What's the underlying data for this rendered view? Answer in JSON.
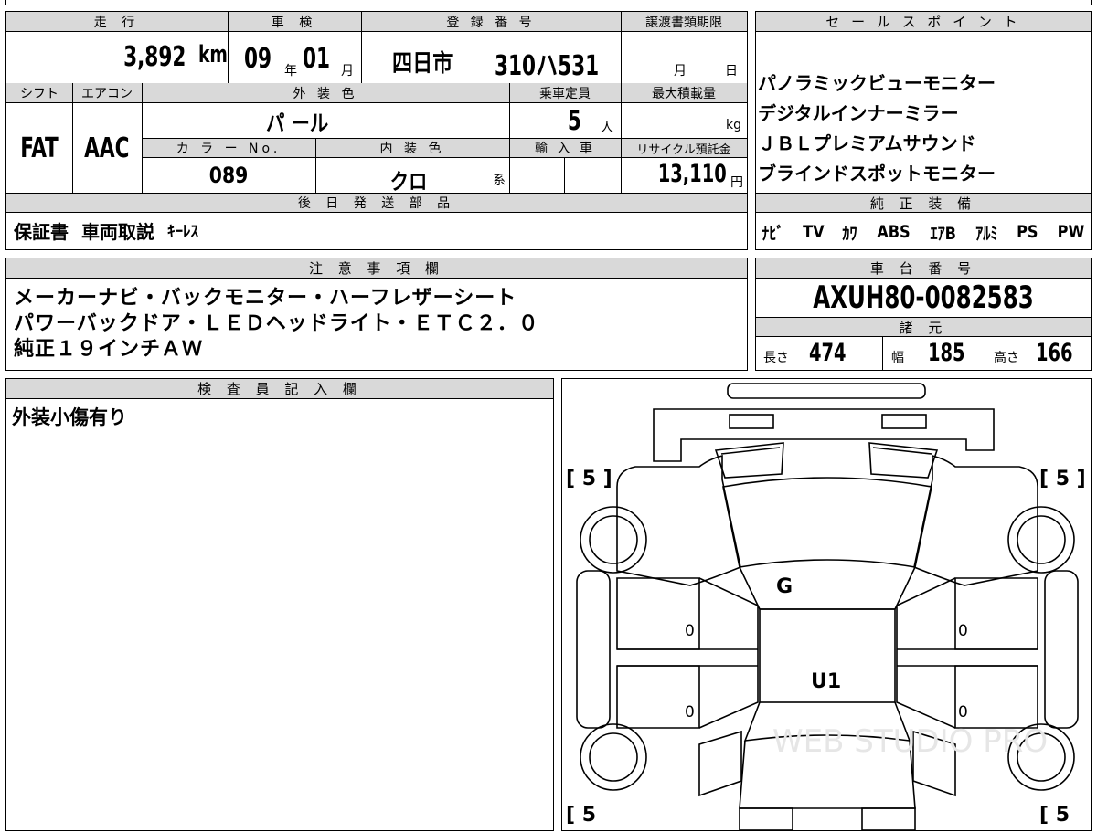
{
  "top_info": {
    "mileage_label": "走 行",
    "mileage_value": "3,892",
    "mileage_unit": "km",
    "inspection_label": "車 検",
    "inspection_year": "09",
    "inspection_year_unit": "年",
    "inspection_month": "01",
    "inspection_month_unit": "月",
    "registration_label": "登 録 番 号",
    "registration_area": "四日市",
    "registration_number": "310ハ531",
    "transfer_deadline_label": "譲渡書類期限",
    "transfer_deadline_month": "月",
    "transfer_deadline_day": "日",
    "shift_label": "シフト",
    "shift_value": "FAT",
    "aircon_label": "エアコン",
    "aircon_value": "AAC",
    "exterior_color_label": "外 装 色",
    "exterior_color_value": "パ ール",
    "capacity_label": "乗車定員",
    "capacity_value": "5",
    "capacity_unit": "人",
    "max_load_label": "最大積載量",
    "max_load_unit": "kg",
    "color_no_label": "カ ラ ー No.",
    "color_no_value": "089",
    "interior_color_label": "内 装 色",
    "interior_color_value": "クロ",
    "interior_color_suffix": "系",
    "import_label": "輸 入 車",
    "recycle_label": "リサイクル預託金",
    "recycle_value": "13,110",
    "recycle_unit": "円",
    "later_parts_label": "後 日 発 送 部 品",
    "later_parts_items": [
      "保証書",
      "車両取説",
      "ｷｰﾚｽ"
    ]
  },
  "sales_points": {
    "label": "セ ー ル ス ポ イ ン ト",
    "items": [
      "パノラミックビューモニター",
      "デジタルインナーミラー",
      "ＪＢＬプレミアムサウンド",
      "ブラインドスポットモニター"
    ],
    "factory_equipment_label": "純 正 装 備",
    "factory_equipment": [
      "ﾅﾋﾞ",
      "TV",
      "ｶﾜ",
      "ABS",
      "ｴｱB",
      "ｱﾙﾐ",
      "PS",
      "PW"
    ]
  },
  "notes": {
    "label": "注 意 事 項 欄",
    "lines": [
      "メーカーナビ・バックモニター・ハーフレザーシート",
      "パワーバックドア・ＬＥＤヘッドライト・ＥＴＣ２．０",
      "純正１９インチＡＷ"
    ]
  },
  "chassis": {
    "label": "車 台 番 号",
    "number": "AXUH80-0082583",
    "specs_label": "諸 元",
    "length_label": "長さ",
    "length_value": "474",
    "width_label": "幅",
    "width_value": "185",
    "height_label": "高さ",
    "height_value": "166"
  },
  "inspector": {
    "label": "検 査 員 記 入 欄",
    "comment": "外装小傷有り"
  },
  "diagram": {
    "tire_front_left": "[ 5 ]",
    "tire_front_right": "[ 5 ]",
    "tire_rear_left": "[ 5",
    "tire_rear_right": "[ 5",
    "windshield_mark": "G",
    "roof_mark": "U1",
    "door_marks": [
      "0",
      "0",
      "0",
      "0"
    ],
    "watermark": "WEB STUDIO PRO"
  }
}
